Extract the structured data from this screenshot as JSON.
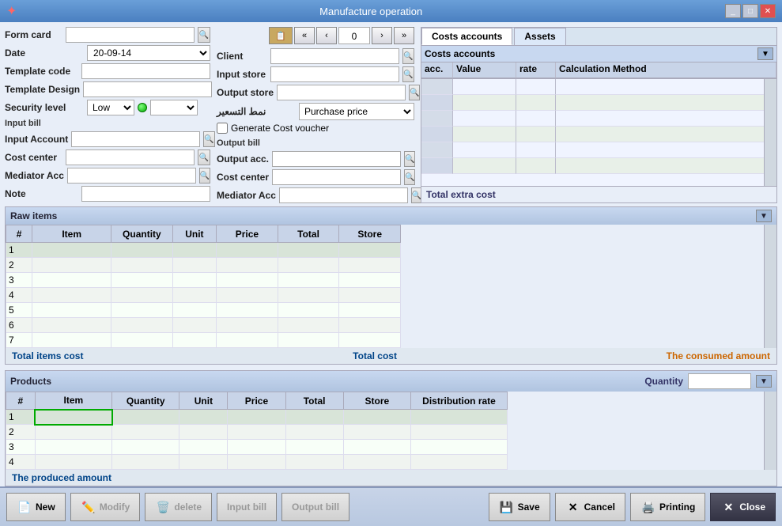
{
  "window": {
    "title": "Manufacture operation",
    "controls": [
      "minimize",
      "maximize",
      "close"
    ]
  },
  "toolbar_top": {
    "form_card_label": "Form card",
    "client_label": "Client",
    "date_label": "Date",
    "date_value": "20-09-14",
    "input_store_label": "Input store",
    "output_store_label": "Output store",
    "template_code_label": "Template code",
    "template_design_label": "Template Design",
    "pricing_mode_label": "نمط التسعير",
    "pricing_mode_value": "Purchase price",
    "generate_cost_label": "Generate Cost voucher",
    "security_label": "Security level",
    "security_value": "Low",
    "counter_value": "0"
  },
  "input_bill": {
    "label": "Input bill",
    "input_account_label": "Input Account",
    "cost_center_label": "Cost center",
    "mediator_acc_label": "Mediator Acc"
  },
  "output_bill": {
    "label": "Output bill",
    "output_acc_label": "Output acc.",
    "cost_center_label": "Cost center",
    "mediator_acc_label": "Mediator Acc"
  },
  "note": {
    "label": "Note"
  },
  "costs_accounts": {
    "tab_label": "Costs accounts",
    "header_label": "Costs accounts",
    "columns": [
      "acc.",
      "Value",
      "rate",
      "Calculation Method"
    ],
    "rows": [
      {
        "acc": "",
        "value": "",
        "rate": "",
        "method": ""
      },
      {
        "acc": "",
        "value": "",
        "rate": "",
        "method": ""
      },
      {
        "acc": "",
        "value": "",
        "rate": "",
        "method": ""
      },
      {
        "acc": "",
        "value": "",
        "rate": "",
        "method": ""
      },
      {
        "acc": "",
        "value": "",
        "rate": "",
        "method": ""
      },
      {
        "acc": "",
        "value": "",
        "rate": "",
        "method": ""
      }
    ],
    "total_label": "Total extra cost"
  },
  "assets_tab": {
    "label": "Assets"
  },
  "raw_items": {
    "section_label": "Raw items",
    "columns": [
      "#",
      "Item",
      "Quantity",
      "Unit",
      "Price",
      "Total",
      "Store"
    ],
    "rows": [
      {
        "num": "1",
        "item": "",
        "qty": "",
        "unit": "",
        "price": "",
        "total": "",
        "store": ""
      },
      {
        "num": "2",
        "item": "",
        "qty": "",
        "unit": "",
        "price": "",
        "total": "",
        "store": ""
      },
      {
        "num": "3",
        "item": "",
        "qty": "",
        "unit": "",
        "price": "",
        "total": "",
        "store": ""
      },
      {
        "num": "4",
        "item": "",
        "qty": "",
        "unit": "",
        "price": "",
        "total": "",
        "store": ""
      },
      {
        "num": "5",
        "item": "",
        "qty": "",
        "unit": "",
        "price": "",
        "total": "",
        "store": ""
      },
      {
        "num": "6",
        "item": "",
        "qty": "",
        "unit": "",
        "price": "",
        "total": "",
        "store": ""
      },
      {
        "num": "7",
        "item": "",
        "qty": "",
        "unit": "",
        "price": "",
        "total": "",
        "store": ""
      }
    ],
    "total_items_cost_label": "Total items cost",
    "total_cost_label": "Total cost",
    "consumed_amount_label": "The consumed amount"
  },
  "products": {
    "section_label": "Products",
    "quantity_label": "Quantity",
    "columns": [
      "#",
      "Item",
      "Quantity",
      "Unit",
      "Price",
      "Total",
      "Store",
      "Distribution rate"
    ],
    "rows": [
      {
        "num": "1",
        "item": "",
        "qty": "",
        "unit": "",
        "price": "",
        "total": "",
        "store": "",
        "dist_rate": ""
      },
      {
        "num": "2",
        "item": "",
        "qty": "",
        "unit": "",
        "price": "",
        "total": "",
        "store": "",
        "dist_rate": ""
      },
      {
        "num": "3",
        "item": "",
        "qty": "",
        "unit": "",
        "price": "",
        "total": "",
        "store": "",
        "dist_rate": ""
      },
      {
        "num": "4",
        "item": "",
        "qty": "",
        "unit": "",
        "price": "",
        "total": "",
        "store": "",
        "dist_rate": ""
      }
    ],
    "produced_amount_label": "The produced amount"
  },
  "buttons": {
    "new_label": "New",
    "modify_label": "Modify",
    "delete_label": "delete",
    "input_bill_label": "Input bill",
    "output_bill_label": "Output bill",
    "save_label": "Save",
    "cancel_label": "Cancel",
    "printing_label": "Printing",
    "close_label": "Close"
  }
}
